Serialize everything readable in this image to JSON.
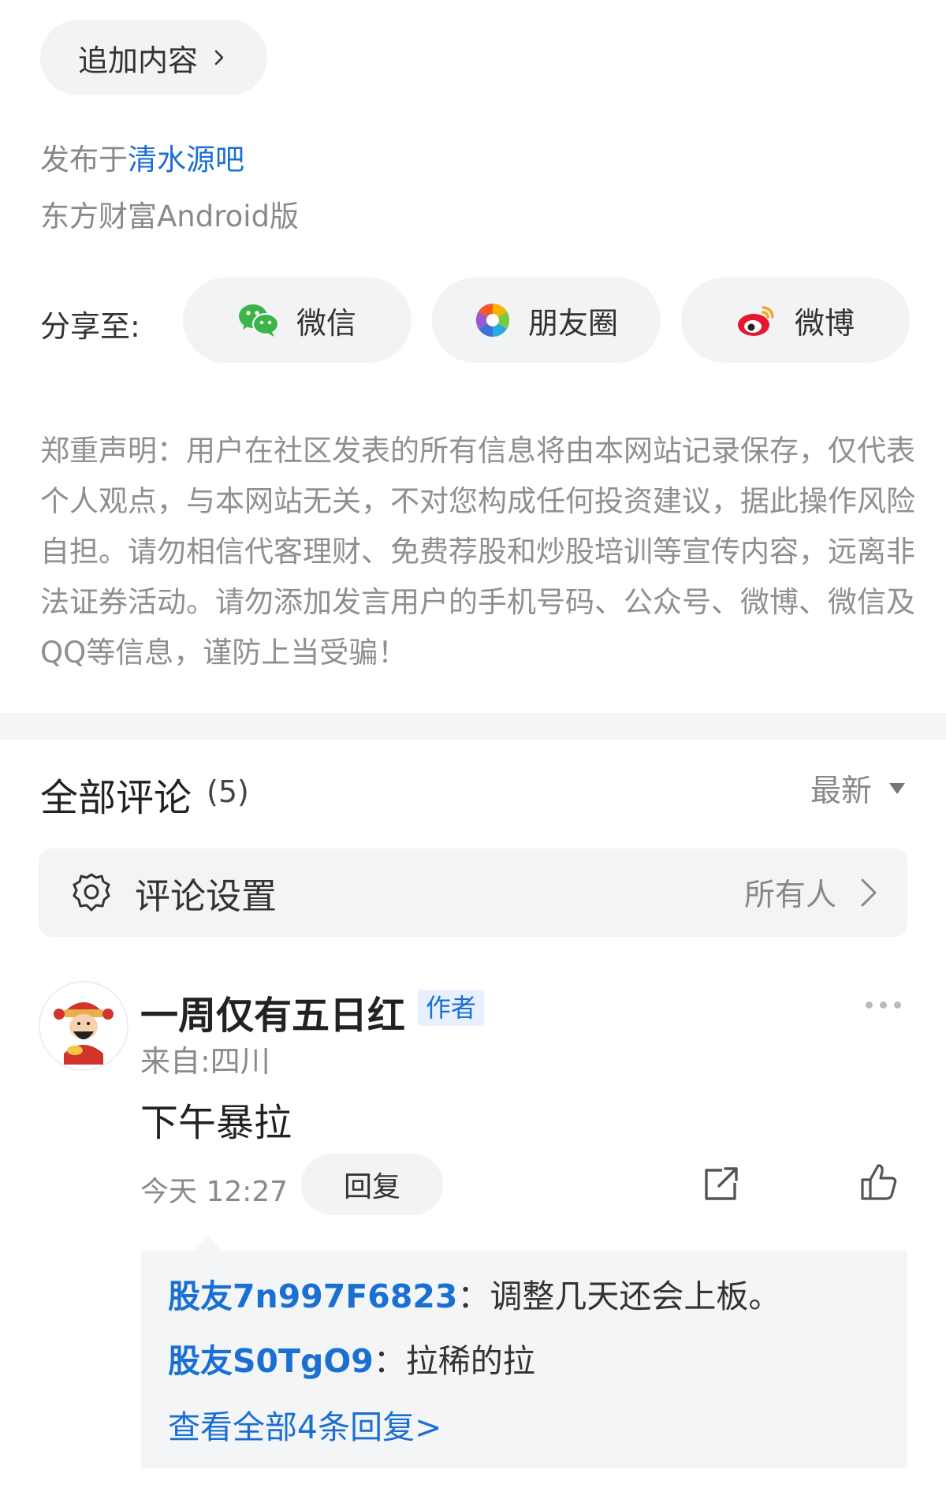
{
  "post_footer": {
    "append_label": "追加内容",
    "published_prefix": "发布于",
    "bar_name": "清水源吧",
    "client": "东方财富Android版"
  },
  "share": {
    "label": "分享至:",
    "buttons": [
      {
        "label": "微信",
        "icon": "wechat-icon",
        "color": "#3bb54a"
      },
      {
        "label": "朋友圈",
        "icon": "moments-icon"
      },
      {
        "label": "微博",
        "icon": "weibo-icon",
        "color": "#e6162d"
      }
    ]
  },
  "disclaimer": "郑重声明：用户在社区发表的所有信息将由本网站记录保存，仅代表个人观点，与本网站无关，不对您构成任何投资建议，据此操作风险自担。请勿相信代客理财、免费荐股和炒股培训等宣传内容，远离非法证券活动。请勿添加发言用户的手机号码、公众号、微博、微信及QQ等信息，谨防上当受骗！",
  "comments": {
    "title": "全部评论",
    "count": "(5)",
    "sort_label": "最新",
    "settings_label": "评论设置",
    "settings_value": "所有人",
    "items": [
      {
        "author": "一周仅有五日红",
        "tag": "作者",
        "location": "来自:四川",
        "text": "下午暴拉",
        "time": "今天 12:27",
        "reply_label": "回复",
        "replies": [
          {
            "user": "股友7n997F6823",
            "sep": "：",
            "text": "调整几天还会上板。"
          },
          {
            "user": "股友S0TgO9",
            "sep": "：",
            "text": "拉稀的拉"
          }
        ],
        "view_all": "查看全部4条回复>"
      }
    ]
  },
  "colors": {
    "link": "#1a6fd3",
    "muted": "#8a8a8a",
    "pill_bg": "#f2f3f5"
  }
}
